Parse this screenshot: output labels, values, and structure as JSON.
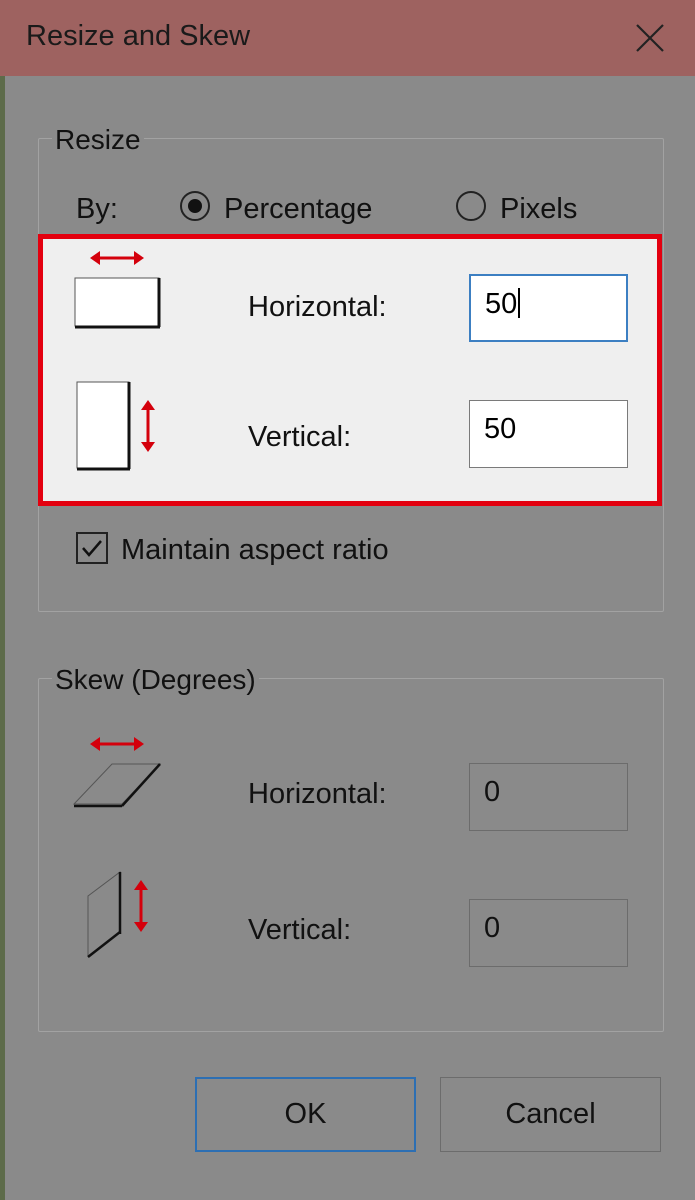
{
  "window": {
    "title": "Resize and Skew"
  },
  "resize": {
    "group_label": "Resize",
    "by_label": "By:",
    "options": [
      {
        "label": "Percentage",
        "selected": true
      },
      {
        "label": "Pixels",
        "selected": false
      }
    ],
    "horizontal_label": "Horizontal:",
    "horizontal_value": "50",
    "vertical_label": "Vertical:",
    "vertical_value": "50",
    "maintain_aspect_label": "Maintain aspect ratio",
    "maintain_aspect_checked": true
  },
  "skew": {
    "group_label": "Skew (Degrees)",
    "horizontal_label": "Horizontal:",
    "horizontal_value": "0",
    "vertical_label": "Vertical:",
    "vertical_value": "0"
  },
  "buttons": {
    "ok": "OK",
    "cancel": "Cancel"
  },
  "colors": {
    "title_bar": "#9e6260",
    "highlight": "#e3000f",
    "arrow": "#d4000c",
    "focus": "#3c7fc2"
  },
  "icons": [
    "close-icon",
    "resize-horizontal-icon",
    "resize-vertical-icon",
    "skew-horizontal-icon",
    "skew-vertical-icon",
    "checkmark-icon"
  ]
}
